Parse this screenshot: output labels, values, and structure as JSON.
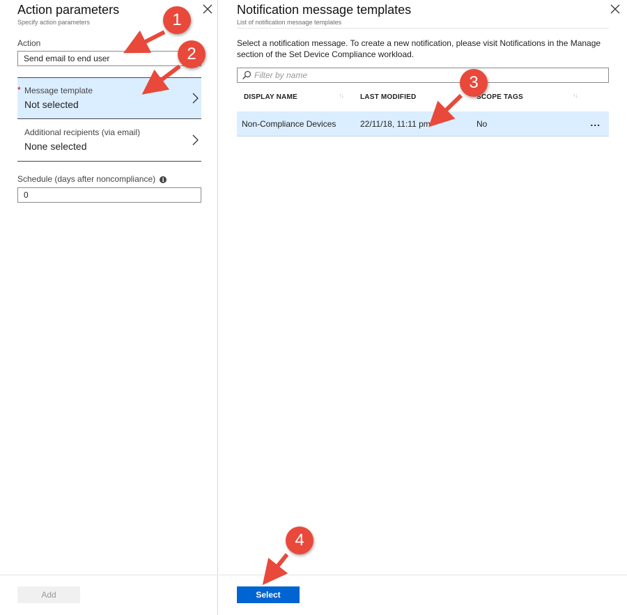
{
  "left_blade": {
    "title": "Action parameters",
    "subtitle": "Specify action parameters",
    "action_label": "Action",
    "action_value": "Send email to end user",
    "message_template": {
      "required_mark": "*",
      "label": "Message template",
      "value": "Not selected"
    },
    "additional_recipients": {
      "label": "Additional recipients (via email)",
      "value": "None selected"
    },
    "schedule_label": "Schedule (days after noncompliance)",
    "schedule_value": "0",
    "add_button": "Add"
  },
  "right_blade": {
    "title": "Notification message templates",
    "subtitle": "List of notification message templates",
    "description": "Select a notification message. To create a new notification, please visit Notifications in the Manage section of the Set Device Compliance workload.",
    "filter_placeholder": "Filter by name",
    "columns": [
      "DISPLAY NAME",
      "LAST MODIFIED",
      "SCOPE TAGS"
    ],
    "rows": [
      {
        "display_name": "Non-Compliance Devices",
        "last_modified": "22/11/18, 11:11 pm",
        "scope_tags": "No",
        "more": "..."
      }
    ],
    "select_button": "Select"
  },
  "callouts": [
    "1",
    "2",
    "3",
    "4"
  ],
  "colors": {
    "accent": "#0064d2",
    "selected_row": "#dbeeff",
    "callout": "#e8493b",
    "required": "#c00000"
  },
  "icons": [
    "close-icon",
    "chevron-right-icon",
    "info-icon",
    "search-icon",
    "sort-icon",
    "more-icon"
  ]
}
